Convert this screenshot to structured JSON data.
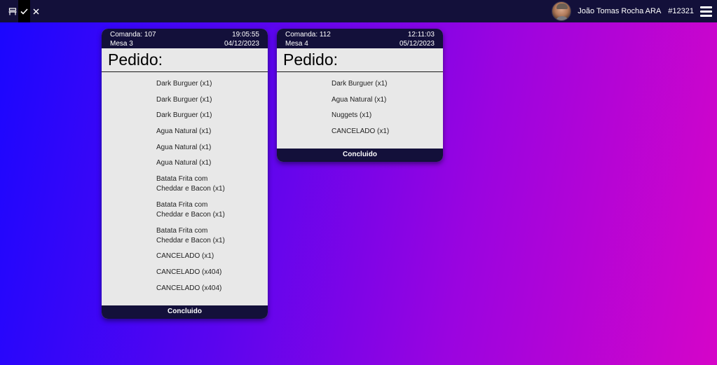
{
  "topbar": {
    "icons": [
      "bench-icon",
      "check-icon",
      "close-icon"
    ],
    "user": {
      "name": "João Tomas Rocha ARA",
      "id": "#12321"
    }
  },
  "orders": [
    {
      "comanda": "Comanda: 107",
      "time": "19:05:55",
      "mesa": "Mesa 3",
      "date": "04/12/2023",
      "title": "Pedido:",
      "items": [
        "Dark Burguer (x1)",
        "Dark Burguer (x1)",
        "Dark Burguer (x1)",
        "Agua Natural (x1)",
        "Agua Natural (x1)",
        "Agua Natural (x1)",
        "Batata Frita com Cheddar e Bacon (x1)",
        "Batata Frita com Cheddar e Bacon (x1)",
        "Batata Frita com Cheddar e Bacon (x1)",
        "CANCELADO (x1)",
        "CANCELADO (x404)",
        "CANCELADO (x404)"
      ],
      "footer": "Concluido"
    },
    {
      "comanda": "Comanda: 112",
      "time": "12:11:03",
      "mesa": "Mesa 4",
      "date": "05/12/2023",
      "title": "Pedido:",
      "items": [
        "Dark Burguer (x1)",
        "Agua Natural (x1)",
        "Nuggets (x1)",
        "CANCELADO (x1)"
      ],
      "footer": "Concluido"
    }
  ]
}
